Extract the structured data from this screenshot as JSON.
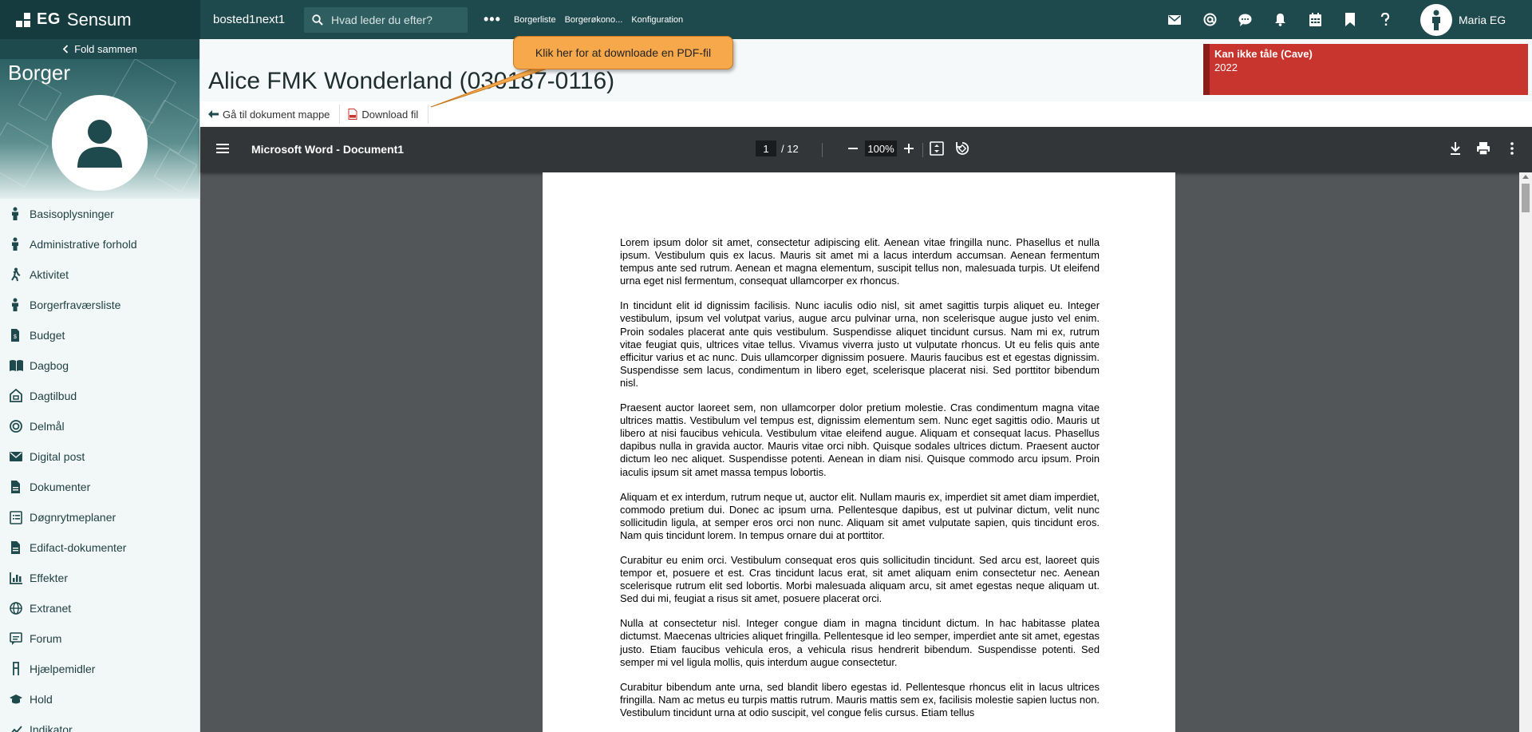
{
  "app": {
    "brand_eg": "EG",
    "brand_name": "Sensum",
    "environment": "bosted1next1",
    "search_placeholder": "Hvad leder du efter?",
    "more": "•••",
    "nav": [
      "Borgerliste",
      "Borgerøkono...",
      "Konfiguration"
    ],
    "top_icons": [
      "mail-icon",
      "at-icon",
      "chat-icon",
      "bell-icon",
      "calendar-icon",
      "bookmark-icon",
      "help-icon"
    ],
    "user_name": "Maria EG"
  },
  "sidebar": {
    "fold_label": "Fold sammen",
    "title": "Borger",
    "items": [
      {
        "label": "Basisoplysninger",
        "icon": "person-icon"
      },
      {
        "label": "Administrative forhold",
        "icon": "person-icon"
      },
      {
        "label": "Aktivitet",
        "icon": "hiking-icon"
      },
      {
        "label": "Borgerfraværsliste",
        "icon": "person-icon"
      },
      {
        "label": "Budget",
        "icon": "budget-document-icon"
      },
      {
        "label": "Dagbog",
        "icon": "book-icon"
      },
      {
        "label": "Dagtilbud",
        "icon": "house-icon"
      },
      {
        "label": "Delmål",
        "icon": "target-icon"
      },
      {
        "label": "Digital post",
        "icon": "mail-icon"
      },
      {
        "label": "Dokumenter",
        "icon": "document-icon"
      },
      {
        "label": "Døgnrytmeplaner",
        "icon": "list-icon"
      },
      {
        "label": "Edifact-dokumenter",
        "icon": "document-icon"
      },
      {
        "label": "Effekter",
        "icon": "chart-icon"
      },
      {
        "label": "Extranet",
        "icon": "globe-icon"
      },
      {
        "label": "Forum",
        "icon": "forum-icon"
      },
      {
        "label": "Hjælpemidler",
        "icon": "crutch-icon"
      },
      {
        "label": "Hold",
        "icon": "graduation-cap-icon"
      },
      {
        "label": "Indikator",
        "icon": "trend-icon"
      }
    ]
  },
  "header": {
    "title": "Alice FMK Wonderland (030187-0116)",
    "actions": {
      "goto_folder": "Gå til dokument mappe",
      "download": "Download fil"
    },
    "alert": {
      "title": "Kan ikke tåle (Cave)",
      "year": "2022",
      "color": "#c8352e"
    }
  },
  "callout": {
    "text": "Klik her for at downloade en PDF-fil"
  },
  "viewer": {
    "doc_title": "Microsoft Word - Document1",
    "page_current": "1",
    "page_total": "/ 12",
    "zoom": "100%",
    "paragraphs": [
      "Lorem ipsum dolor sit amet, consectetur adipiscing elit. Aenean vitae fringilla nunc. Phasellus et nulla ipsum. Vestibulum quis ex lacus. Mauris sit amet mi a lacus interdum accumsan. Aenean fermentum tempus ante sed rutrum. Aenean et magna elementum, suscipit tellus non, malesuada turpis. Ut eleifend urna eget nisl fermentum, consequat ullamcorper ex rhoncus.",
      "In tincidunt elit id dignissim facilisis. Nunc iaculis odio nisl, sit amet sagittis turpis aliquet eu. Integer vestibulum, ipsum vel volutpat varius, augue arcu pulvinar urna, non scelerisque augue justo vel enim. Proin sodales placerat ante quis vestibulum. Suspendisse aliquet tincidunt cursus. Nam mi ex, rutrum vitae feugiat quis, ultrices vitae tellus. Vivamus viverra justo ut vulputate rhoncus. Ut eu felis quis ante efficitur varius et ac nunc. Duis ullamcorper dignissim posuere. Mauris faucibus est et egestas dignissim. Suspendisse sem lacus, condimentum in libero eget, scelerisque placerat nisi. Sed porttitor bibendum nisl.",
      "Praesent auctor laoreet sem, non ullamcorper dolor pretium molestie. Cras condimentum magna vitae ultrices mattis. Vestibulum vel tempus est, dignissim elementum sem. Nunc eget sagittis odio. Mauris ut libero at nisi faucibus vehicula. Vestibulum vitae eleifend augue. Aliquam et consequat lacus. Phasellus dapibus nulla in gravida auctor. Mauris vitae orci nibh. Quisque sodales ultrices dictum. Praesent auctor dictum leo nec aliquet. Suspendisse potenti. Aenean in diam nisi. Quisque commodo arcu ipsum. Proin iaculis ipsum sit amet massa tempus lobortis.",
      "Aliquam et ex interdum, rutrum neque ut, auctor elit. Nullam mauris ex, imperdiet sit amet diam imperdiet, commodo pretium dui. Donec ac ipsum urna. Pellentesque dapibus, est ut pulvinar dictum, velit nunc sollicitudin ligula, at semper eros orci non nunc. Aliquam sit amet vulputate sapien, quis tincidunt eros. Nam quis tincidunt lorem. In tempus ornare dui at porttitor.",
      "Curabitur eu enim orci. Vestibulum consequat eros quis sollicitudin tincidunt. Sed arcu est, laoreet quis tempor et, posuere et est. Cras tincidunt lacus erat, sit amet aliquam enim consectetur nec. Aenean scelerisque rutrum elit sed lobortis. Morbi malesuada aliquam arcu, sit amet egestas neque aliquam ut. Sed dui mi, feugiat a risus sit amet, posuere placerat orci.",
      "Nulla at consectetur nisl. Integer congue diam in magna tincidunt dictum. In hac habitasse platea dictumst. Maecenas ultricies aliquet fringilla. Pellentesque id leo semper, imperdiet ante sit amet, egestas justo. Etiam faucibus vehicula eros, a vehicula risus hendrerit bibendum. Suspendisse potenti. Sed semper mi vel ligula mollis, quis interdum augue consectetur.",
      "Curabitur bibendum ante urna, sed blandit libero egestas id. Pellentesque rhoncus elit in lacus ultrices fringilla. Nam ac metus eu turpis mattis rutrum. Mauris mattis sem ex, facilisis molestie sapien luctus non. Vestibulum tincidunt urna at odio suscipit, vel congue felis cursus. Etiam tellus"
    ]
  }
}
